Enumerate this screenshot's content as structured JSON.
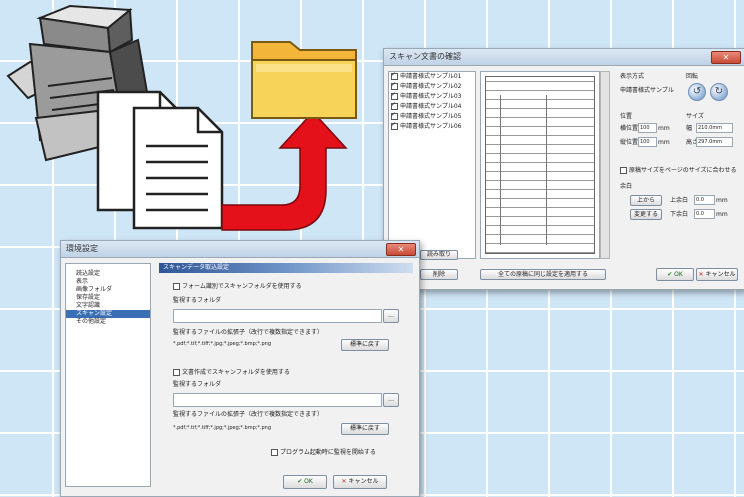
{
  "preview": {
    "title": "スキャン文書の確認",
    "list_items": [
      "申請書様式サンプル01",
      "申請書様式サンプル02",
      "申請書様式サンプル03",
      "申請書様式サンプル04",
      "申請書様式サンプル05",
      "申請書様式サンプル06"
    ],
    "side": {
      "display_label": "表示方式",
      "display_value": "申請書様式サンプル",
      "rotate_label": "回転",
      "position_label": "位置",
      "size_label": "サイズ",
      "pos_x_label": "横位置",
      "pos_x_value": "100",
      "pos_y_label": "縦位置",
      "pos_y_value": "100",
      "unit": "mm",
      "width_label": "幅",
      "width_value": "210.0mm",
      "height_label": "高さ",
      "height_value": "297.0mm",
      "option_label": "原稿サイズをページのサイズに合わせる",
      "margin_label": "余白",
      "margin_top_label": "上余白",
      "margin_top_value": "0.0",
      "margin_bottom_label": "下余白",
      "margin_bottom_value": "0.0",
      "left_field_a": "上から",
      "left_field_b": "変更する"
    },
    "buttons": {
      "list_a": "読み取り",
      "list_b": "削除",
      "middle": "全ての原稿に同じ設定を適用する",
      "ok": "OK",
      "cancel": "キャンセル"
    }
  },
  "settings": {
    "title": "環境設定",
    "tree": [
      "読込設定",
      "表示",
      "画像フォルダ",
      "保存設定",
      "文字認識",
      "スキャン設定",
      "その他設定"
    ],
    "selected_index": 5,
    "header": "スキャンデータ取込設定",
    "opt1_label": "フォーム識別でスキャンフォルダを使用する",
    "opt1_folder_label": "監視するフォルダ",
    "opt1_ext_label": "監視するファイルの拡張子（改行で複数指定できます）",
    "opt1_ext_value": "*.pdf;*.tif;*.tiff;*.jpg;*.jpeg;*.bmp;*.png",
    "opt1_reset": "標準に戻す",
    "opt2_label": "文書作成でスキャンフォルダを使用する",
    "opt2_folder_label": "監視するフォルダ",
    "opt2_ext_label": "監視するファイルの拡張子（改行で複数指定できます）",
    "opt2_ext_value": "*.pdf;*.tif;*.tiff;*.jpg;*.jpeg;*.bmp;*.png",
    "opt2_reset": "標準に戻す",
    "footer_check": "プログラム起動時に監視を開始する",
    "ok": "OK",
    "cancel": "キャンセル",
    "browse": "…"
  },
  "colors": {
    "background": "#cfe6f7",
    "folder": "#f7c948",
    "arrow": "#e4101a"
  }
}
